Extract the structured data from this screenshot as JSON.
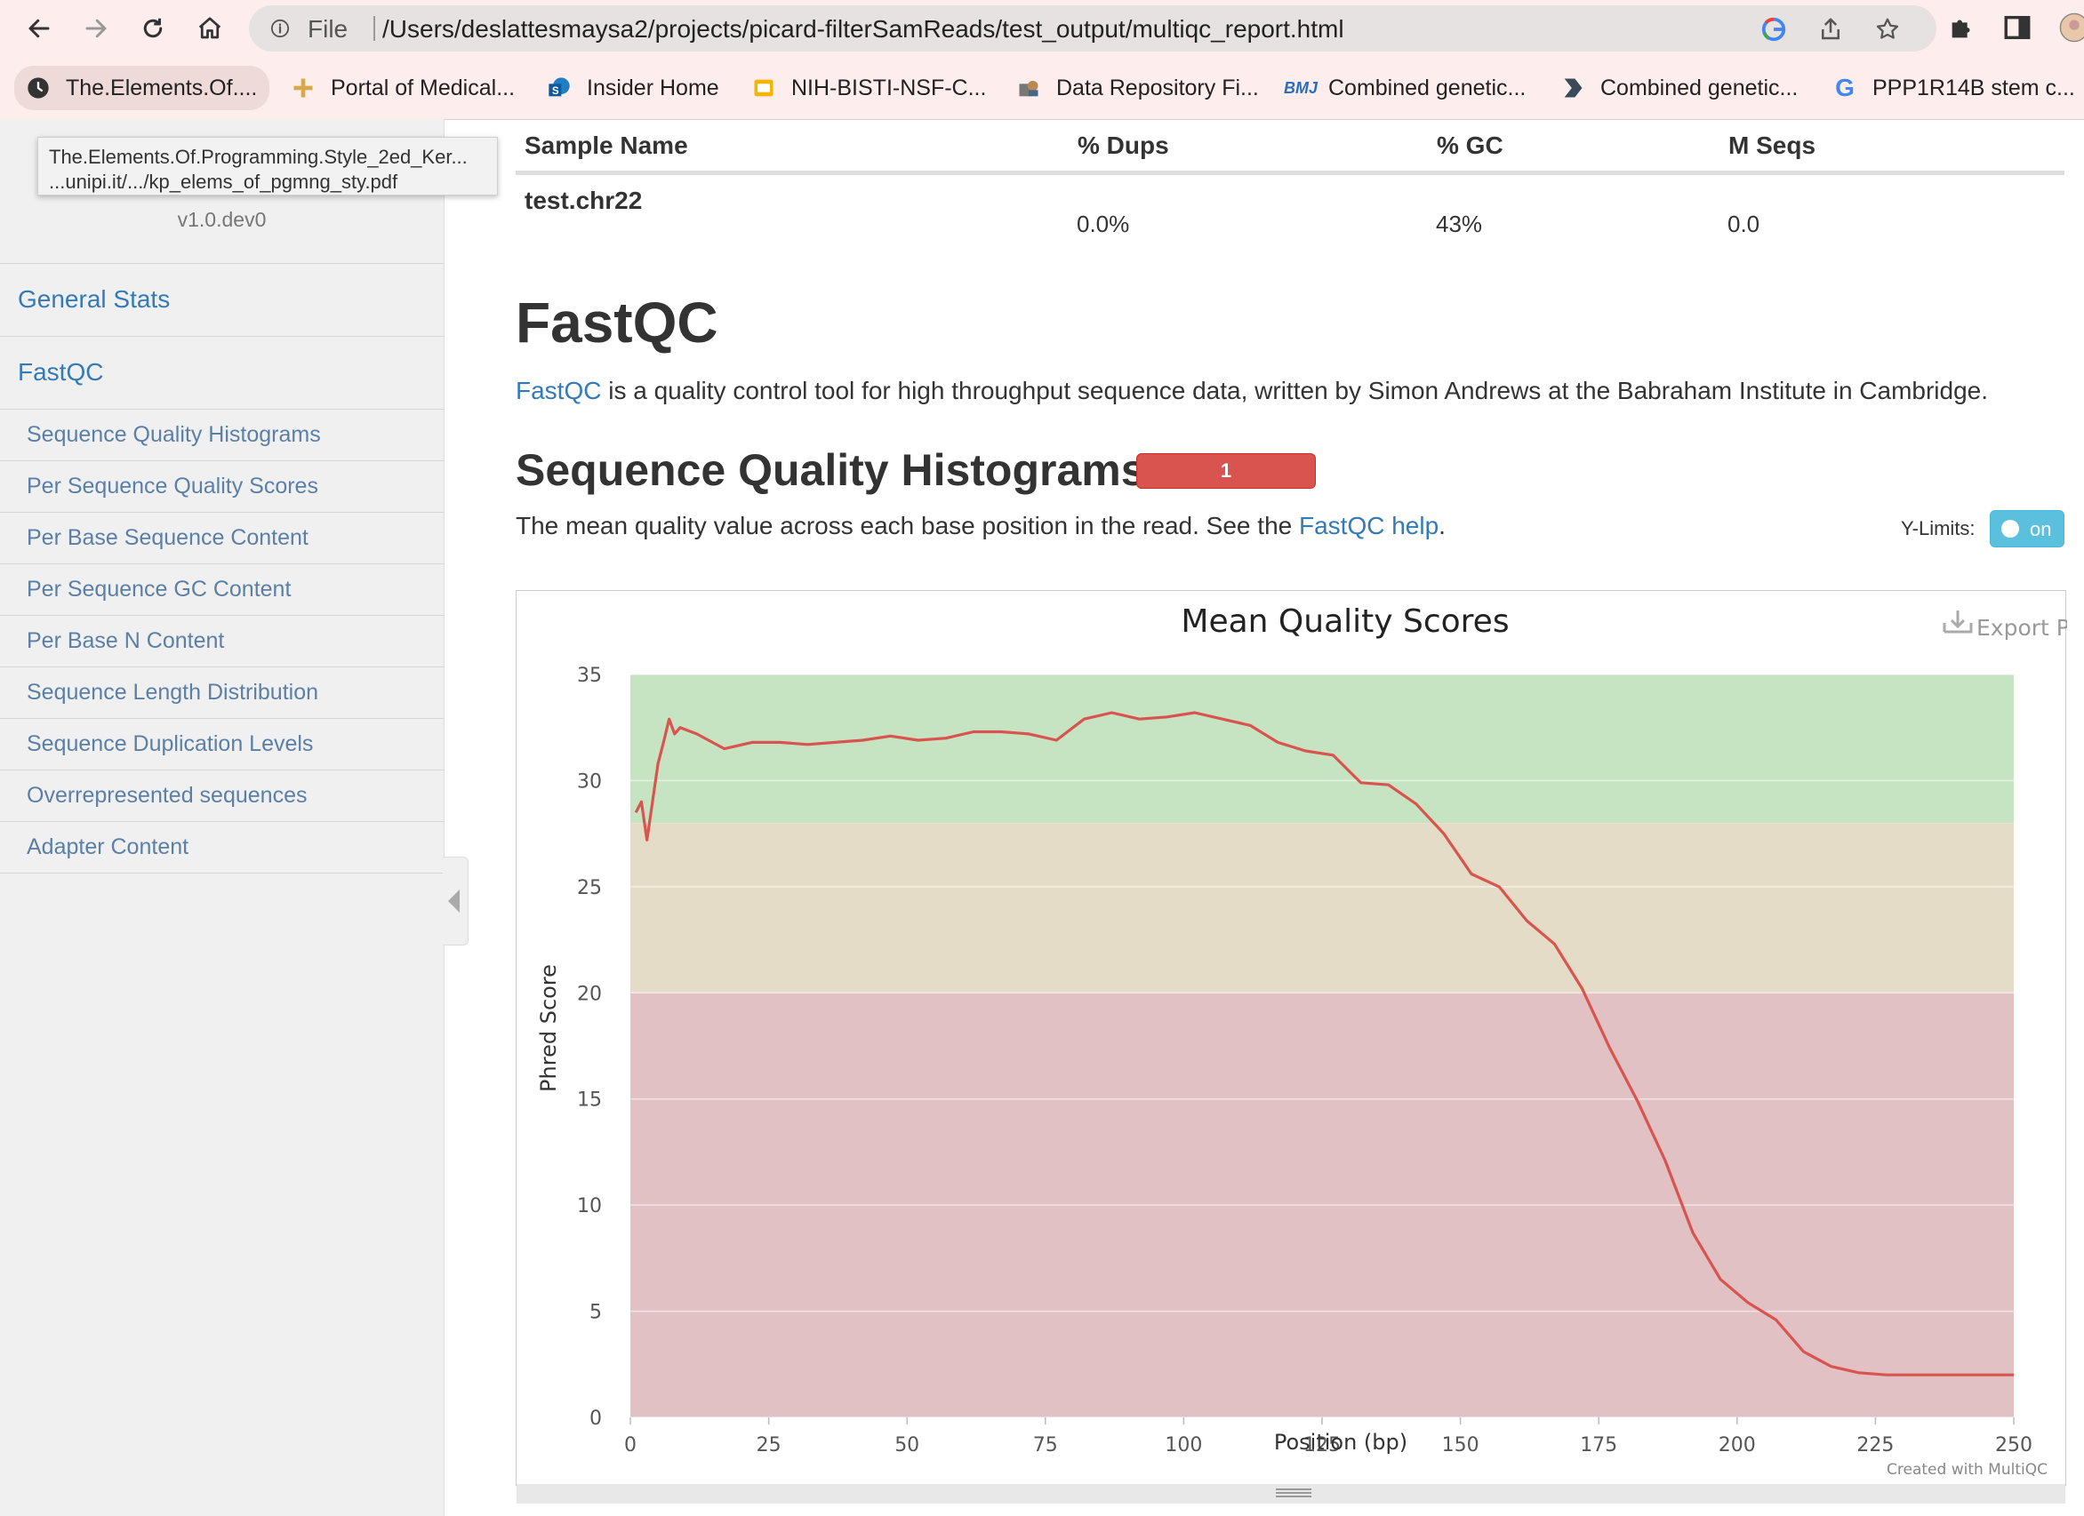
{
  "browser": {
    "url_scheme": "File",
    "url": "/Users/deslattesmaysa2/projects/picard-filterSamReads/test_output/multiqc_report.html",
    "bookmarks": [
      {
        "label": "The.Elements.Of....",
        "icon": "chrome-globe-icon"
      },
      {
        "label": "Portal of Medical...",
        "icon": "medical-portal-icon"
      },
      {
        "label": "Insider Home",
        "icon": "sharepoint-icon"
      },
      {
        "label": "NIH-BISTI-NSF-C...",
        "icon": "slides-icon"
      },
      {
        "label": "Data Repository Fi...",
        "icon": "repository-icon"
      },
      {
        "label": "Combined genetic...",
        "icon": "bmj-icon"
      },
      {
        "label": "Combined genetic...",
        "icon": "bookmark-arrow-icon"
      },
      {
        "label": "PPP1R14B stem c...",
        "icon": "google-icon"
      }
    ]
  },
  "sidebar": {
    "tooltip_line1": "The.Elements.Of.Programming.Style_2ed_Ker...",
    "tooltip_line2": "...unipi.it/.../kp_elems_of_pgmng_sty.pdf",
    "version": "v1.0.dev0",
    "main_items": [
      "General Stats",
      "FastQC"
    ],
    "sub_items": [
      "Sequence Quality Histograms",
      "Per Sequence Quality Scores",
      "Per Base Sequence Content",
      "Per Sequence GC Content",
      "Per Base N Content",
      "Sequence Length Distribution",
      "Sequence Duplication Levels",
      "Overrepresented sequences",
      "Adapter Content"
    ]
  },
  "general_stats": {
    "headers": [
      "Sample Name",
      "% Dups",
      "% GC",
      "M Seqs"
    ],
    "row": [
      "test.chr22",
      "0.0%",
      "43%",
      "0.0"
    ]
  },
  "fastqc": {
    "title": "FastQC",
    "intro_link": "FastQC",
    "intro_text": " is a quality control tool for high throughput sequence data, written by Simon Andrews at the Babraham Institute in Cambridge.",
    "section_title": "Sequence Quality Histograms",
    "badge_count": "1",
    "desc_prefix": "The mean quality value across each base position in the read. See the ",
    "desc_link": "FastQC help",
    "desc_suffix": ".",
    "ylimits_label": "Y-Limits:",
    "toggle_label": "on",
    "export_label": "Export Plot",
    "credit": "Created with MultiQC"
  },
  "chart_data": {
    "type": "line",
    "title": "Mean Quality Scores",
    "xlabel": "Position (bp)",
    "ylabel": "Phred Score",
    "xlim": [
      0,
      250
    ],
    "ylim": [
      0,
      35
    ],
    "x_ticks": [
      0,
      25,
      50,
      75,
      100,
      125,
      150,
      175,
      200,
      225,
      250
    ],
    "y_ticks": [
      0,
      5,
      10,
      15,
      20,
      25,
      30,
      35
    ],
    "bands": [
      {
        "from": 28,
        "to": 35,
        "color": "#c6e4c2"
      },
      {
        "from": 20,
        "to": 28,
        "color": "#e5dcc7"
      },
      {
        "from": 0,
        "to": 20,
        "color": "#e2c1c5"
      }
    ],
    "series_color": "#d9534f",
    "series": [
      {
        "x": [
          1,
          2,
          3,
          4,
          5,
          6,
          7,
          8,
          9,
          12,
          17,
          22,
          27,
          32,
          37,
          42,
          47,
          52,
          57,
          62,
          67,
          72,
          77,
          82,
          87,
          92,
          97,
          102,
          107,
          112,
          117,
          122,
          127,
          132,
          137,
          142,
          147,
          152,
          157,
          162,
          167,
          172,
          177,
          182,
          187,
          192,
          197,
          202,
          207,
          212,
          217,
          222,
          227,
          232,
          237,
          242,
          247,
          250
        ],
        "y": [
          28.5,
          29,
          27.2,
          29,
          30.8,
          31.8,
          32.9,
          32.2,
          32.5,
          32.2,
          31.5,
          31.8,
          31.8,
          31.7,
          31.8,
          31.9,
          32.1,
          31.9,
          32.0,
          32.3,
          32.3,
          32.2,
          31.9,
          32.9,
          33.2,
          32.9,
          33.0,
          33.2,
          32.9,
          32.6,
          31.8,
          31.4,
          31.2,
          29.9,
          29.8,
          28.9,
          27.5,
          25.6,
          25.0,
          23.4,
          22.3,
          20.2,
          17.4,
          14.9,
          12.1,
          8.7,
          6.5,
          5.4,
          4.6,
          3.1,
          2.4,
          2.1,
          2.0,
          2.0,
          2.0,
          2.0,
          2.0,
          2.0
        ]
      }
    ]
  }
}
